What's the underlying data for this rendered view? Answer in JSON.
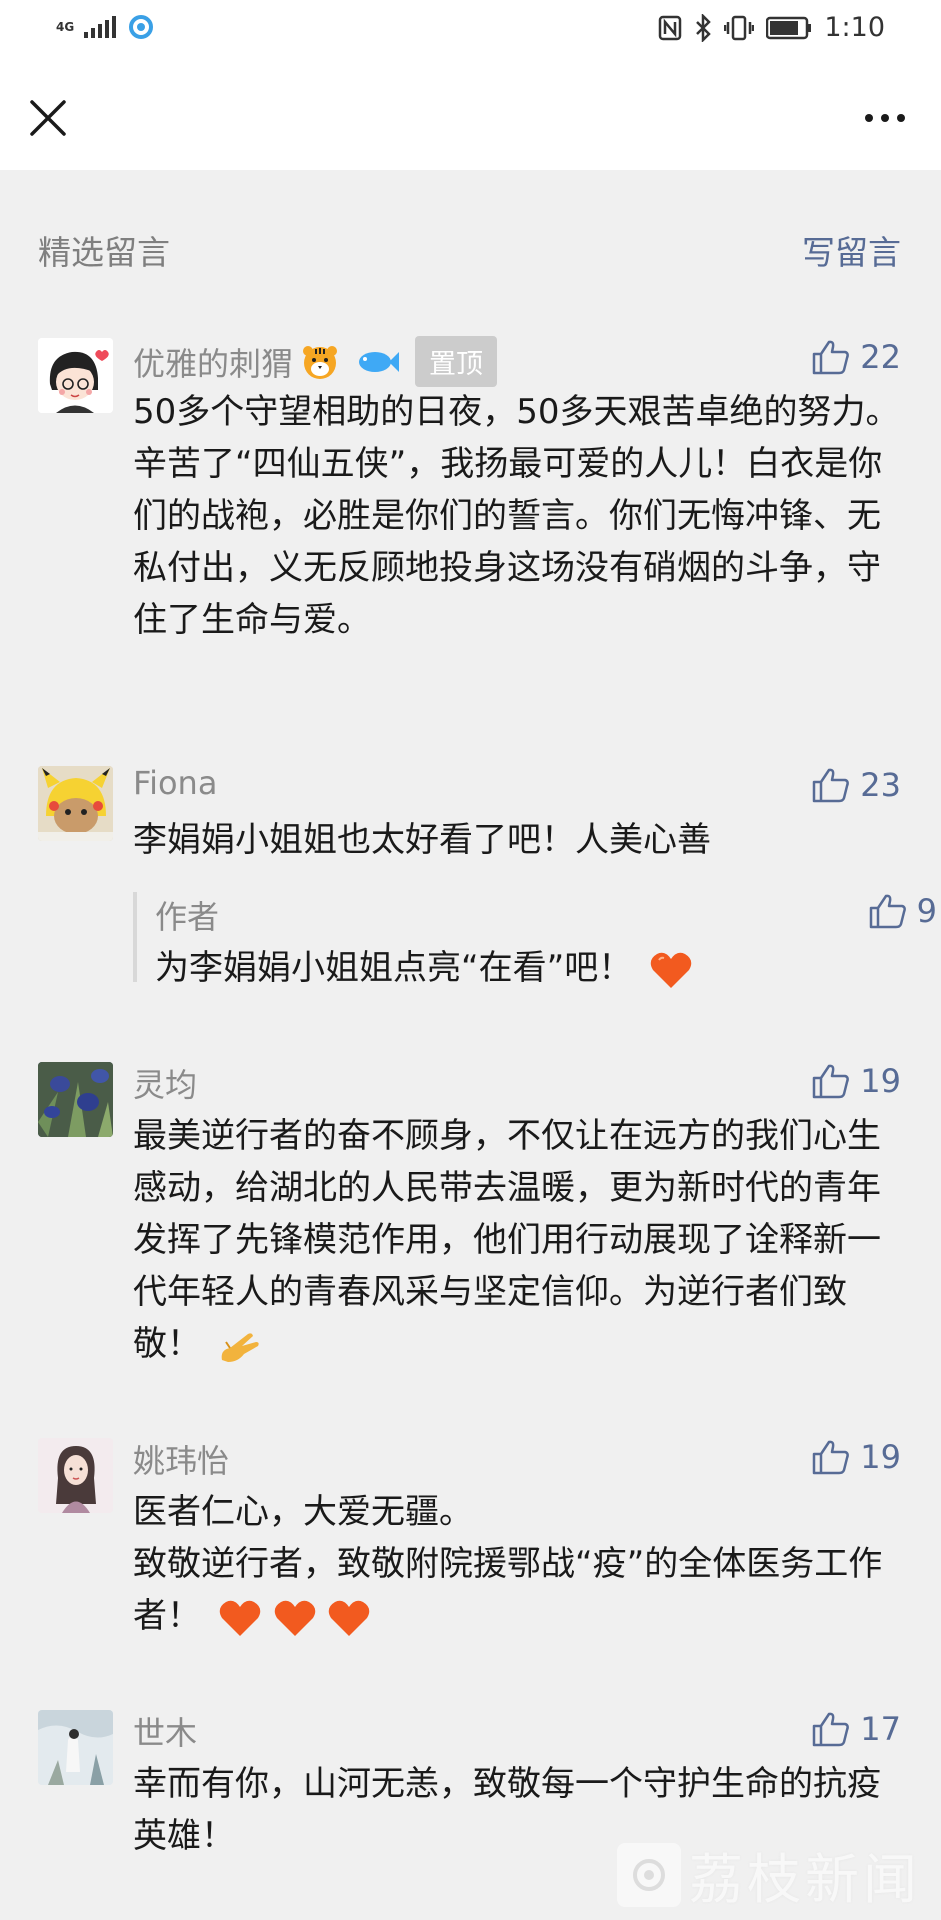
{
  "status_bar": {
    "network": "4G",
    "time": "1:10"
  },
  "nav": {
    "close_icon": "close-icon",
    "more_icon": "more-dots-icon"
  },
  "section": {
    "title": "精选留言",
    "write_link": "写留言"
  },
  "comments": [
    {
      "nickname": "优雅的刺猬",
      "emoji_after_name": [
        "tiger-face-emoji",
        "fish-emoji"
      ],
      "pinned_label": "置顶",
      "likes": "22",
      "text": "50多个守望相助的日夜，50多天艰苦卓绝的努力。辛苦了“四仙五侠”，我扬最可爱的人儿！白衣是你们的战袍，必胜是你们的誓言。你们无悔冲锋、无私付出，义无反顾地投身这场没有硝烟的斗争，守住了生命与爱。"
    },
    {
      "nickname": "Fiona",
      "likes": "23",
      "text": "李娟娟小姐姐也太好看了吧！人美心善",
      "reply": {
        "author": "作者",
        "likes": "9",
        "text": "为李娟娟小姐姐点亮“在看”吧！"
      }
    },
    {
      "nickname": "灵均",
      "likes": "19",
      "text": "最美逆行者的奋不顾身，不仅让在远方的我们心生感动，给湖北的人民带去温暖，更为新时代的青年发挥了先锋模范作用，他们用行动展现了诠释新一代年轻人的青春风采与坚定信仰。为逆行者们致敬！"
    },
    {
      "nickname": "姚玮怡",
      "likes": "19",
      "text_line1": "医者仁心，大爱无疆。",
      "text_line2": "致敬逆行者，致敬附院援鄂战“疫”的全体医务工作者！"
    },
    {
      "nickname": "世木",
      "likes": "17",
      "text": "幸而有你，山河无恙，致敬每一个守护生命的抗疫英雄！"
    }
  ],
  "watermark": {
    "text": "荔枝新闻"
  },
  "colors": {
    "link": "#576b95",
    "meta": "#8a8a8a",
    "background": "#f0f0f0",
    "heart": "#f25a1f"
  }
}
